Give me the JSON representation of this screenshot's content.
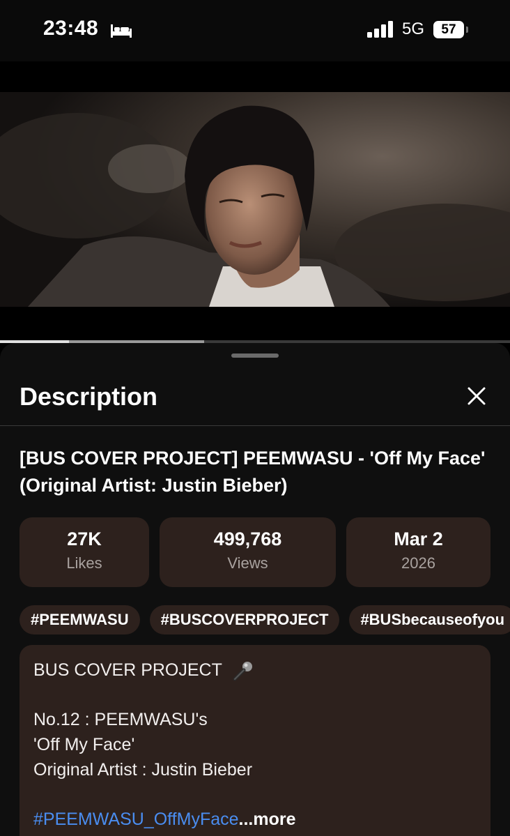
{
  "status_bar": {
    "time": "23:48",
    "network": "5G",
    "battery": "57",
    "icons": [
      "bed-icon",
      "signal-icon",
      "battery-icon"
    ]
  },
  "video": {
    "progress_played": 0.135,
    "progress_buffered": 0.4
  },
  "sheet": {
    "title": "Description",
    "close_icon": "close-icon"
  },
  "video_title": "[BUS COVER PROJECT] PEEMWASU - 'Off My Face' (Original Artist: Justin Bieber)",
  "stats": {
    "likes": {
      "value": "27K",
      "label": "Likes"
    },
    "views": {
      "value": "499,768",
      "label": "Views"
    },
    "date": {
      "value": "Mar 2",
      "label": "2026"
    }
  },
  "hashtags": [
    "#PEEMWASU",
    "#BUSCOVERPROJECT",
    "#BUSbecauseofyou"
  ],
  "description": {
    "line1": "BUS COVER PROJECT",
    "line1_icon": "microphone-icon",
    "line2": "No.12 : PEEMWASU's",
    "line3": "'Off My Face'",
    "line4": "Original Artist : Justin Bieber",
    "hashtag_link": "#PEEMWASU_OffMyFace",
    "more_label": "...more"
  },
  "colors": {
    "sheet_background": "#0f0f0f",
    "card_background": "#2d211d",
    "link": "#4a8df0",
    "secondary_text": "#a9a29f"
  }
}
